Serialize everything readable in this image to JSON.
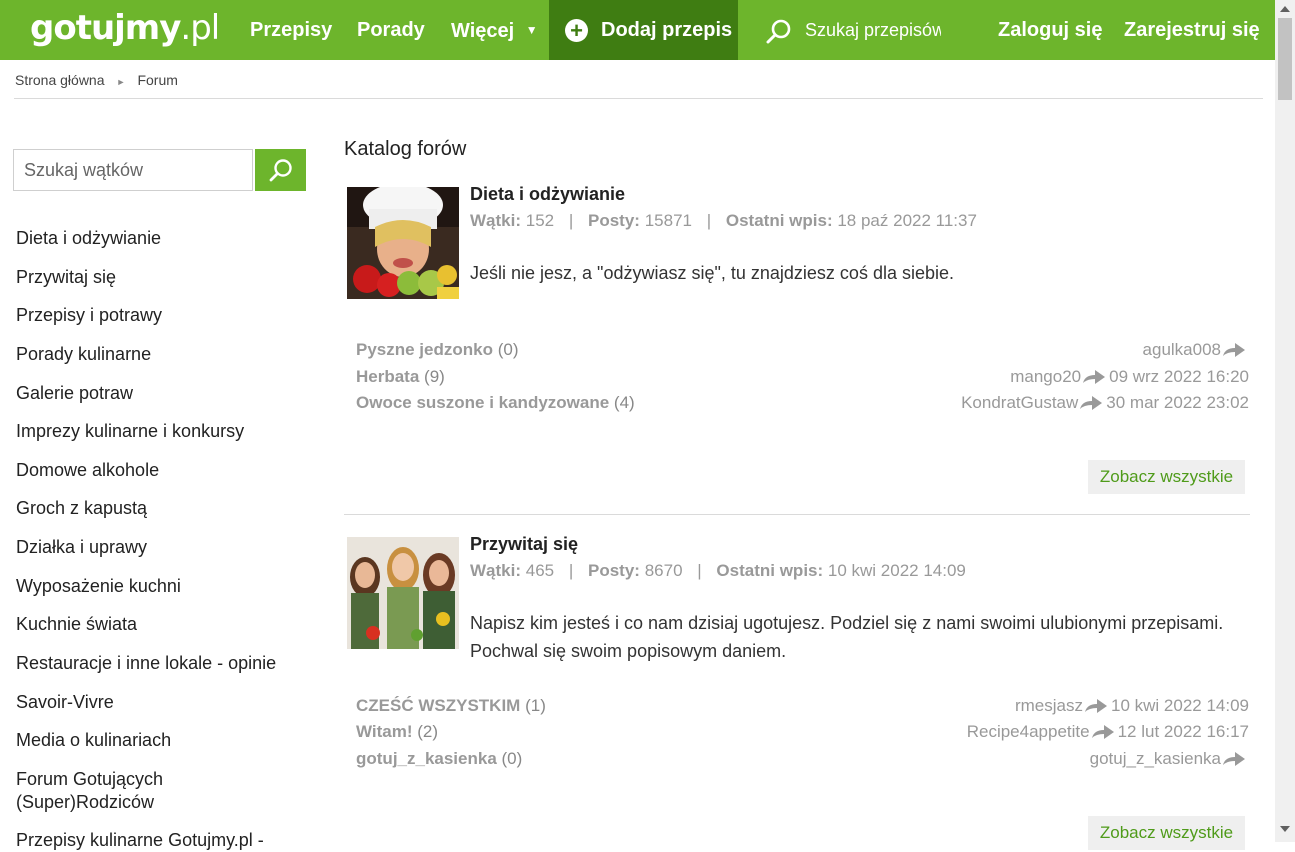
{
  "header": {
    "logo_main": "gotujmy",
    "logo_tld": ".pl",
    "nav": [
      "Przepisy",
      "Porady",
      "Więcej"
    ],
    "add_recipe": "Dodaj przepis",
    "search_placeholder": "Szukaj przepisów",
    "login": "Zaloguj się",
    "register": "Zarejestruj się",
    "brand_color": "#6db52c",
    "accent_dark": "#3f7d12"
  },
  "breadcrumb": [
    "Strona główna",
    "Forum"
  ],
  "sidebar": {
    "search_placeholder": "Szukaj wątków",
    "items": [
      "Dieta i odżywianie",
      "Przywitaj się",
      "Przepisy i potrawy",
      "Porady kulinarne",
      "Galerie potraw",
      "Imprezy kulinarne i konkursy",
      "Domowe alkohole",
      "Groch z kapustą",
      "Działka i uprawy",
      "Wyposażenie kuchni",
      "Kuchnie świata",
      "Restauracje i inne lokale - opinie",
      "Savoir-Vivre",
      "Media o kulinariach",
      "Forum Gotujących (Super)Rodziców",
      "Przepisy kulinarne Gotujmy.pl -"
    ]
  },
  "main": {
    "title": "Katalog forów",
    "labels": {
      "threads": "Wątki:",
      "posts": "Posty:",
      "last_post": "Ostatni wpis:",
      "see_all": "Zobacz wszystkie"
    },
    "forums": [
      {
        "name": "Dieta i odżywianie",
        "threads": "152",
        "posts": "15871",
        "last_post": "18 paź 2022 11:37",
        "description": "Jeśli nie jesz, a \"odżywiasz się\", tu znajdziesz coś dla siebie.",
        "topics": [
          {
            "title": "Pyszne jedzonko",
            "count": "(0)",
            "user": "agulka008",
            "date": ""
          },
          {
            "title": "Herbata",
            "count": "(9)",
            "user": "mango20",
            "date": "09 wrz 2022 16:20"
          },
          {
            "title": "Owoce suszone i kandyzowane",
            "count": "(4)",
            "user": "KondratGustaw",
            "date": "30 mar 2022 23:02"
          }
        ]
      },
      {
        "name": "Przywitaj się",
        "threads": "465",
        "posts": "8670",
        "last_post": "10 kwi 2022 14:09",
        "description": "Napisz kim jesteś i co nam dzisiaj ugotujesz. Podziel się z nami swoimi ulubionymi przepisami. Pochwal się swoim popisowym daniem.",
        "topics": [
          {
            "title": "CZEŚĆ WSZYSTKIM",
            "count": "(1)",
            "user": "rmesjasz",
            "date": "10 kwi 2022 14:09"
          },
          {
            "title": "Witam!",
            "count": "(2)",
            "user": "Recipe4appetite",
            "date": "12 lut 2022 16:17"
          },
          {
            "title": "gotuj_z_kasienka",
            "count": "(0)",
            "user": "gotuj_z_kasienka",
            "date": ""
          }
        ]
      }
    ]
  }
}
